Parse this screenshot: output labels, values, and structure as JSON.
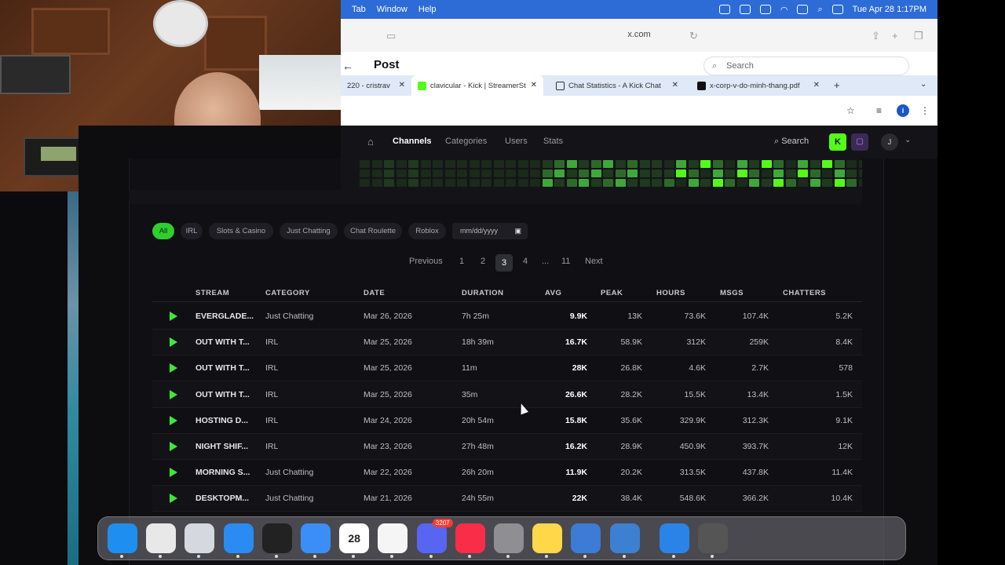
{
  "menubar": {
    "items": [
      "Tab",
      "Window",
      "Help"
    ],
    "clock": "Tue Apr 28  1:17PM"
  },
  "safari": {
    "url": "x.com",
    "post_title": "Post",
    "search_placeholder": "Search"
  },
  "tabs": [
    {
      "label": "220 - cristrav",
      "active": false
    },
    {
      "label": "clavicular - Kick | StreamerSt",
      "active": true
    },
    {
      "label": "Chat Statistics - A Kick Chat",
      "active": false
    },
    {
      "label": "x-corp-v-do-minh-thang.pdf",
      "active": false
    }
  ],
  "kick_nav": {
    "items": [
      "Channels",
      "Categories",
      "Users",
      "Stats"
    ],
    "active": "Channels",
    "search": "Search",
    "user_initial": "J"
  },
  "filters": {
    "chips": [
      "All",
      "IRL",
      "Slots & Casino",
      "Just Chatting",
      "Chat Roulette",
      "Roblox"
    ],
    "active": "All",
    "date_placeholder": "mm/dd/yyyy"
  },
  "pagination": {
    "previous": "Previous",
    "pages": [
      "1",
      "2",
      "3",
      "4",
      "...",
      "11"
    ],
    "current": "3",
    "next": "Next"
  },
  "table": {
    "headers": [
      "STREAM",
      "CATEGORY",
      "DATE",
      "DURATION",
      "AVG",
      "PEAK",
      "HOURS",
      "MSGS",
      "CHATTERS"
    ],
    "rows": [
      {
        "stream": "EVERGLADE...",
        "category": "Just Chatting",
        "date": "Mar 26, 2026",
        "duration": "7h 25m",
        "avg": "9.9K",
        "peak": "13K",
        "hours": "73.6K",
        "msgs": "107.4K",
        "chatters": "5.2K"
      },
      {
        "stream": "OUT WITH T...",
        "category": "IRL",
        "date": "Mar 25, 2026",
        "duration": "18h 39m",
        "avg": "16.7K",
        "peak": "58.9K",
        "hours": "312K",
        "msgs": "259K",
        "chatters": "8.4K"
      },
      {
        "stream": "OUT WITH T...",
        "category": "IRL",
        "date": "Mar 25, 2026",
        "duration": "11m",
        "avg": "28K",
        "peak": "26.8K",
        "hours": "4.6K",
        "msgs": "2.7K",
        "chatters": "578"
      },
      {
        "stream": "OUT WITH T...",
        "category": "IRL",
        "date": "Mar 25, 2026",
        "duration": "35m",
        "avg": "26.6K",
        "peak": "28.2K",
        "hours": "15.5K",
        "msgs": "13.4K",
        "chatters": "1.5K"
      },
      {
        "stream": "HOSTING D...",
        "category": "IRL",
        "date": "Mar 24, 2026",
        "duration": "20h 54m",
        "avg": "15.8K",
        "peak": "35.6K",
        "hours": "329.9K",
        "msgs": "312.3K",
        "chatters": "9.1K"
      },
      {
        "stream": "NIGHT SHIF...",
        "category": "IRL",
        "date": "Mar 23, 2026",
        "duration": "27h 48m",
        "avg": "16.2K",
        "peak": "28.9K",
        "hours": "450.9K",
        "msgs": "393.7K",
        "chatters": "12K"
      },
      {
        "stream": "MORNING S...",
        "category": "Just Chatting",
        "date": "Mar 22, 2026",
        "duration": "26h 20m",
        "avg": "11.9K",
        "peak": "20.2K",
        "hours": "313.5K",
        "msgs": "437.8K",
        "chatters": "11.4K"
      },
      {
        "stream": "DESKTOPM...",
        "category": "Just Chatting",
        "date": "Mar 21, 2026",
        "duration": "24h 55m",
        "avg": "22K",
        "peak": "38.4K",
        "hours": "548.6K",
        "msgs": "366.2K",
        "chatters": "10.4K"
      }
    ]
  },
  "dock": {
    "apps": [
      {
        "name": "finder",
        "color": "#1e8ff0",
        "label": ""
      },
      {
        "name": "chrome",
        "color": "#e8e8e8",
        "label": ""
      },
      {
        "name": "launchpad",
        "color": "#d5d8de",
        "label": ""
      },
      {
        "name": "safari",
        "color": "#2a8bf2",
        "label": ""
      },
      {
        "name": "obs",
        "color": "#222",
        "label": ""
      },
      {
        "name": "mail",
        "color": "#3a8ef5",
        "label": ""
      },
      {
        "name": "calendar",
        "color": "#ffffff",
        "label": "28"
      },
      {
        "name": "photos",
        "color": "#f5f5f5",
        "label": ""
      },
      {
        "name": "discord",
        "color": "#5865f2",
        "label": "",
        "badge": "3207"
      },
      {
        "name": "music",
        "color": "#fa2d48",
        "label": ""
      },
      {
        "name": "settings",
        "color": "#8e8e93",
        "label": ""
      },
      {
        "name": "notes",
        "color": "#ffd84a",
        "label": ""
      },
      {
        "name": "preview",
        "color": "#3c7bd6",
        "label": ""
      },
      {
        "name": "storage",
        "color": "#3d7fd0",
        "label": ""
      },
      {
        "name": "quicktime",
        "color": "#2a84e8",
        "label": ""
      },
      {
        "name": "calculator",
        "color": "#555",
        "label": ""
      }
    ]
  },
  "colors": {
    "kick_green": "#53fc18",
    "menubar_blue": "#2d6cd6"
  }
}
